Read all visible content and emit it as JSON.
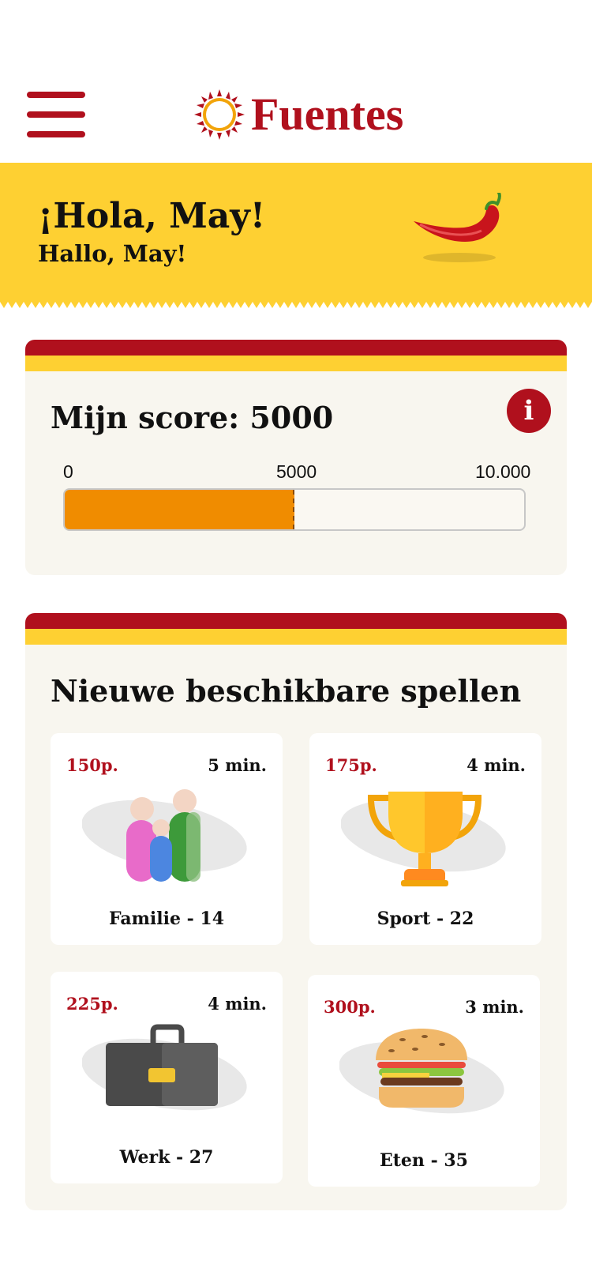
{
  "header": {
    "brand": "Fuentes",
    "menu_icon": "hamburger-menu-icon",
    "brand_color": "#b0101d"
  },
  "greeting": {
    "title": "¡Hola, May!",
    "subtitle": "Hallo, May!",
    "icon": "chili-pepper-icon",
    "background": "#fed032"
  },
  "score": {
    "title": "Mijn score: 5000",
    "info_icon": "info-icon",
    "info_label": "i",
    "tick_min": "0",
    "tick_mid": "5000",
    "tick_max": "10.000",
    "progress": 0.5,
    "bar_color": "#f08c00"
  },
  "games": {
    "title": "Nieuwe beschikbare spellen",
    "items": [
      {
        "points": "150p.",
        "duration": "5 min.",
        "name": "Familie - 14",
        "icon": "family-icon"
      },
      {
        "points": "175p.",
        "duration": "4 min.",
        "name": "Sport - 22",
        "icon": "trophy-icon"
      },
      {
        "points": "225p.",
        "duration": "4 min.",
        "name": "Werk - 27",
        "icon": "briefcase-icon"
      },
      {
        "points": "300p.",
        "duration": "3 min.",
        "name": "Eten - 35",
        "icon": "hamburger-food-icon"
      }
    ]
  }
}
